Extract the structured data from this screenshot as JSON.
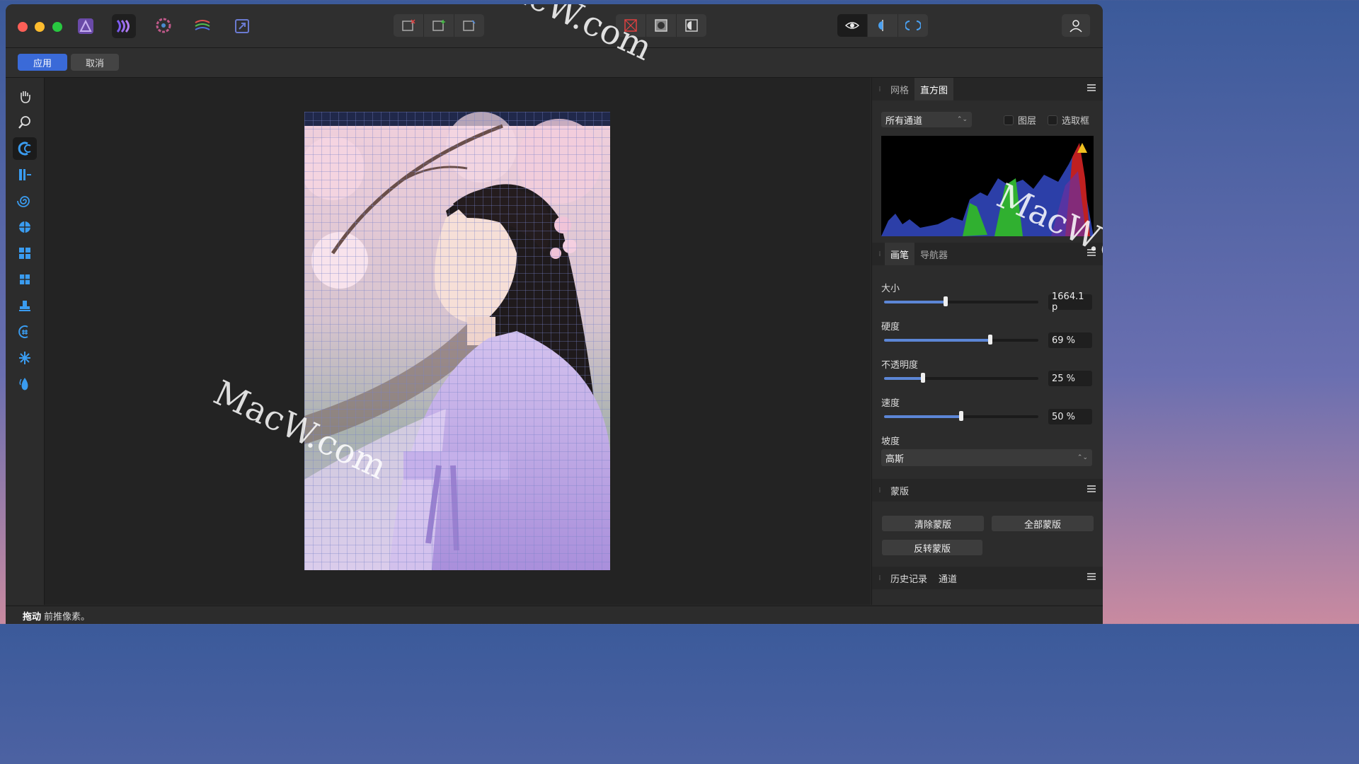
{
  "context_bar": {
    "apply_label": "应用",
    "cancel_label": "取消"
  },
  "panels": {
    "top": {
      "tabs": [
        "网格",
        "直方图"
      ],
      "active_tab": "直方图",
      "channel_select": "所有通道",
      "checkbox_layer": "图层",
      "checkbox_selection": "选取框"
    },
    "brush": {
      "tabs": [
        "画笔",
        "导航器"
      ],
      "active_tab": "画笔",
      "size": {
        "label": "大小",
        "value_text": "1664.1 p",
        "level": 0.4
      },
      "hardness": {
        "label": "硬度",
        "value_text": "69 %",
        "level": 0.69
      },
      "opacity": {
        "label": "不透明度",
        "value_text": "25 %",
        "level": 0.25
      },
      "speed": {
        "label": "速度",
        "value_text": "50 %",
        "level": 0.5
      },
      "falloff": {
        "label": "坡度",
        "value": "高斯"
      }
    },
    "mask": {
      "title": "蒙版",
      "clear_label": "清除蒙版",
      "all_label": "全部蒙版",
      "invert_label": "反转蒙版"
    },
    "history": {
      "tabs": [
        "历史记录",
        "通道"
      ]
    }
  },
  "status": {
    "action": "拖动",
    "text": "前推像素。"
  },
  "watermark": {
    "text1": "MacW.com",
    "text2": "MacW.com",
    "text3": "MacW.c"
  },
  "colors": {
    "accent": "#3a6ad8",
    "slider_fill": "#5c86d6"
  }
}
